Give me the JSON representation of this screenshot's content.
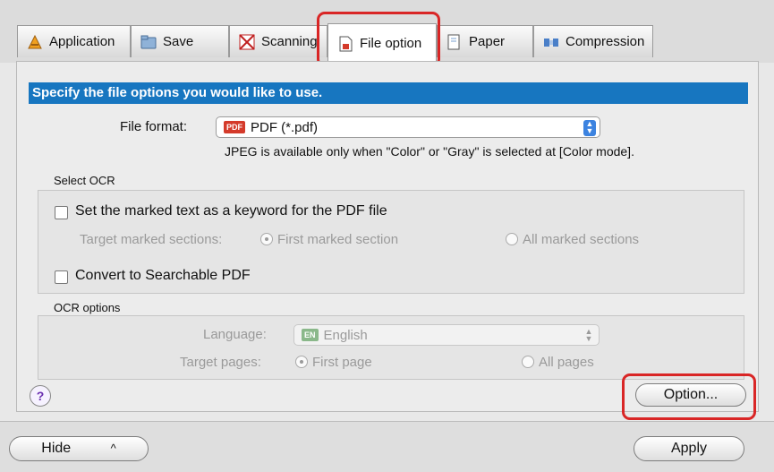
{
  "tabs": [
    {
      "label": "Application",
      "icon": "application-icon"
    },
    {
      "label": "Save",
      "icon": "save-folder-icon"
    },
    {
      "label": "Scanning",
      "icon": "scanning-icon"
    },
    {
      "label": "File option",
      "icon": "file-option-icon",
      "active": true
    },
    {
      "label": "Paper",
      "icon": "paper-icon"
    },
    {
      "label": "Compression",
      "icon": "compression-icon"
    }
  ],
  "banner": "Specify the file options you would like to use.",
  "file_format": {
    "label": "File format:",
    "value": "PDF (*.pdf)",
    "badge": "PDF",
    "note": "JPEG is available only when \"Color\" or \"Gray\" is selected at [Color mode]."
  },
  "select_ocr": {
    "title": "Select OCR",
    "keyword_checkbox": "Set the marked text as a keyword for the PDF file",
    "target_label": "Target marked sections:",
    "radio_first": "First marked section",
    "radio_all": "All marked sections",
    "searchable_checkbox": "Convert to Searchable PDF"
  },
  "ocr_options": {
    "title": "OCR options",
    "language_label": "Language:",
    "language_value": "English",
    "language_badge": "EN",
    "pages_label": "Target pages:",
    "radio_first_page": "First page",
    "radio_all_pages": "All pages"
  },
  "help_label": "?",
  "option_button": "Option...",
  "hide_button": "Hide",
  "hide_chevron": "^",
  "apply_button": "Apply",
  "colors": {
    "accent": "#1776c0",
    "highlight": "#d92626",
    "pdf_badge": "#d43a2a"
  }
}
